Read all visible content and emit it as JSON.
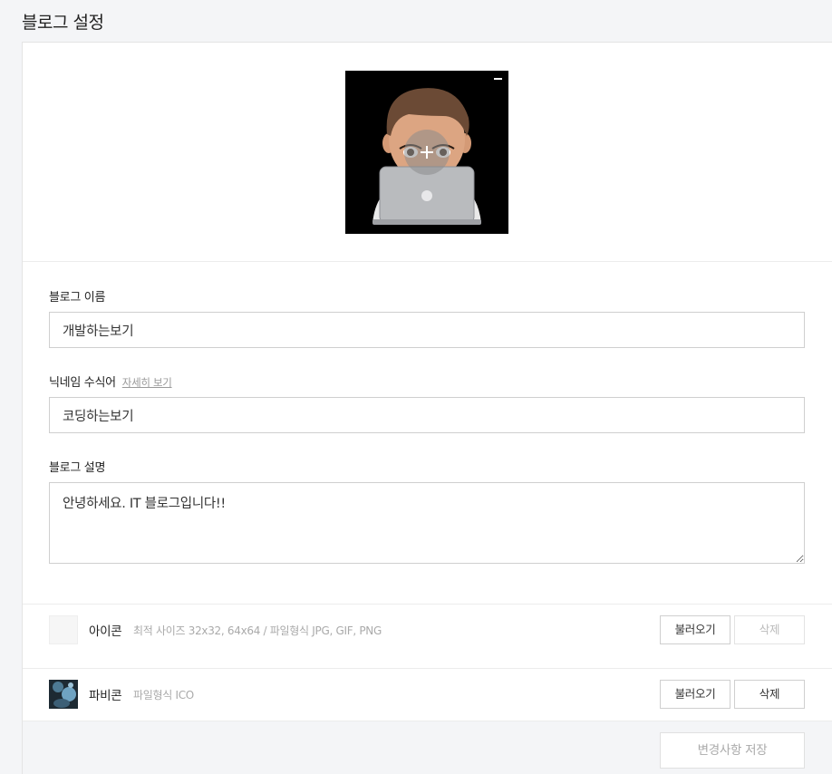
{
  "page": {
    "title": "블로그 설정"
  },
  "profile": {
    "image_icon": "memoji-avatar-with-laptop",
    "remove_icon": "minus-icon",
    "add_icon": "plus-icon"
  },
  "blog_name": {
    "label": "블로그 이름",
    "value": "개발하는보기"
  },
  "nickname": {
    "label": "닉네임 수식어",
    "detail_link": "자세히 보기",
    "value": "코딩하는보기"
  },
  "description": {
    "label": "블로그 설명",
    "value": "안녕하세요. IT 블로그입니다!!"
  },
  "icon": {
    "title": "아이콘",
    "hint": "최적 사이즈 32x32, 64x64 / 파일형식 JPG, GIF, PNG",
    "load_label": "불러오기",
    "delete_label": "삭제"
  },
  "favicon": {
    "title": "파비콘",
    "hint": "파일형식 ICO",
    "load_label": "불러오기",
    "delete_label": "삭제"
  },
  "footer": {
    "save_label": "변경사항 저장"
  }
}
